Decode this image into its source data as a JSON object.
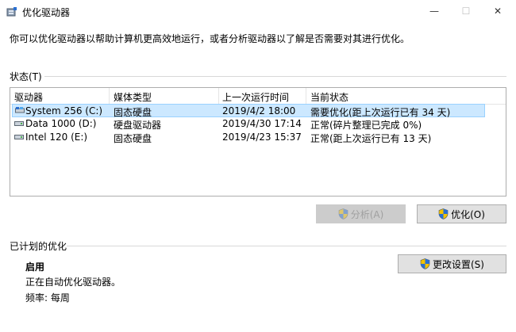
{
  "window": {
    "title": "优化驱动器",
    "minimize_glyph": "—",
    "maximize_glyph": "☐",
    "close_glyph": "✕"
  },
  "description": "你可以优化驱动器以帮助计算机更高效地运行，或者分析驱动器以了解是否需要对其进行优化。",
  "status": {
    "label": "状态(T)",
    "columns": [
      "驱动器",
      "媒体类型",
      "上一次运行时间",
      "当前状态"
    ],
    "rows": [
      {
        "drive": "System 256 (C:)",
        "media": "固态硬盘",
        "last_run": "2019/4/2 18:00",
        "status": "需要优化(距上次运行已有 34 天)",
        "selected": true
      },
      {
        "drive": "Data 1000 (D:)",
        "media": "硬盘驱动器",
        "last_run": "2019/4/30 17:14",
        "status": "正常(碎片整理已完成 0%)",
        "selected": false
      },
      {
        "drive": "Intel 120 (E:)",
        "media": "固态硬盘",
        "last_run": "2019/4/23 15:37",
        "status": "正常(距上次运行已有 13 天)",
        "selected": false
      }
    ]
  },
  "buttons": {
    "analyze": "分析(A)",
    "optimize": "优化(O)",
    "change_settings": "更改设置(S)"
  },
  "scheduled": {
    "label": "已计划的优化",
    "state": "启用",
    "detail": "正在自动优化驱动器。",
    "frequency": "频率: 每周"
  },
  "colors": {
    "selection_bg": "#cce8ff",
    "selection_border": "#99d1ff",
    "button_bg": "#e1e1e1",
    "shield_blue": "#2a6fd1",
    "shield_yellow": "#f2c200"
  }
}
